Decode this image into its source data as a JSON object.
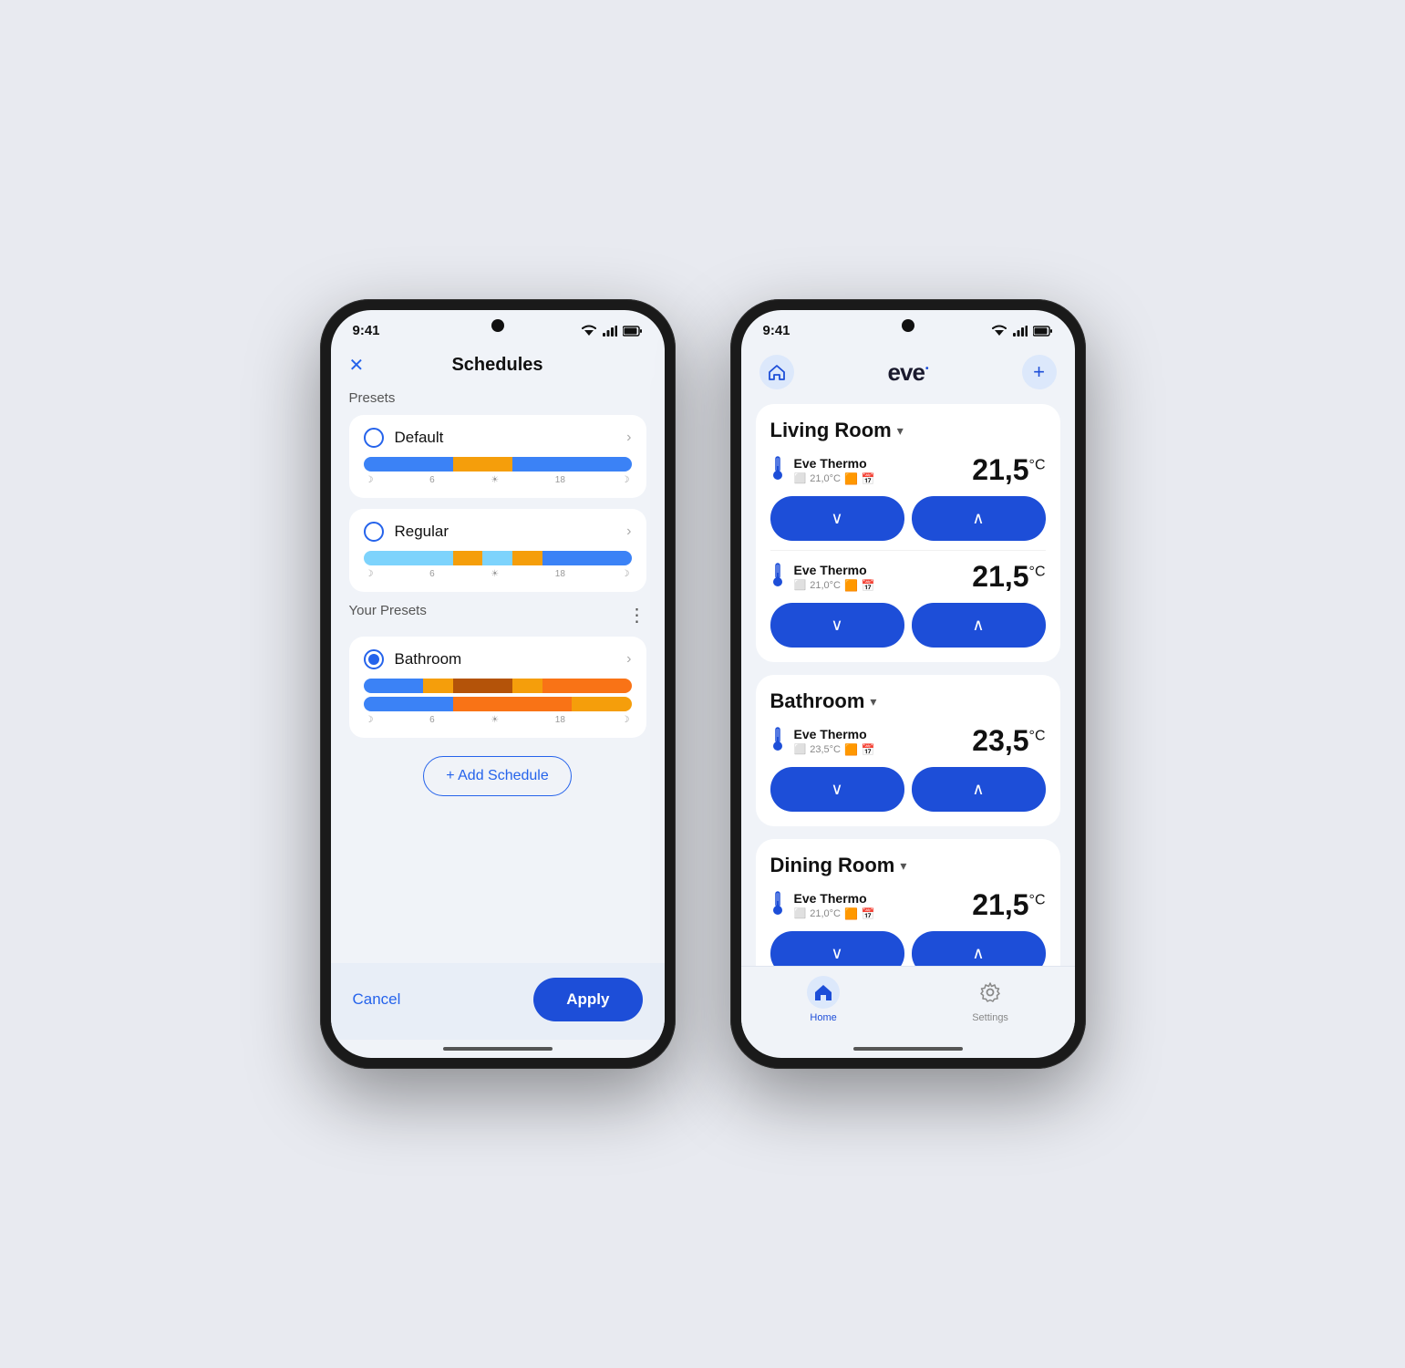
{
  "phone1": {
    "statusBar": {
      "time": "9:41"
    },
    "header": {
      "title": "Schedules",
      "closeLabel": "✕"
    },
    "sections": {
      "presets": "Presets",
      "yourPresets": "Your Presets"
    },
    "presets": [
      {
        "name": "Default",
        "selected": false,
        "segments": [
          {
            "color": "#3b82f6",
            "flex": 3
          },
          {
            "color": "#f59e0b",
            "flex": 2
          },
          {
            "color": "#3b82f6",
            "flex": 1
          },
          {
            "color": "#3b82f6",
            "flex": 3
          }
        ]
      },
      {
        "name": "Regular",
        "selected": false,
        "segments": [
          {
            "color": "#7dd3fc",
            "flex": 3
          },
          {
            "color": "#f59e0b",
            "flex": 1
          },
          {
            "color": "#7dd3fc",
            "flex": 1
          },
          {
            "color": "#f59e0b",
            "flex": 1
          },
          {
            "color": "#3b82f6",
            "flex": 3
          }
        ]
      }
    ],
    "yourPresets": [
      {
        "name": "Bathroom",
        "selected": true,
        "segments": [
          {
            "color": "#3b82f6",
            "flex": 2
          },
          {
            "color": "#f59e0b",
            "flex": 1
          },
          {
            "color": "#b45309",
            "flex": 2
          },
          {
            "color": "#f59e0b",
            "flex": 1
          },
          {
            "color": "#f97316",
            "flex": 3
          }
        ]
      }
    ],
    "barLabels": [
      "☽",
      "6",
      "☀",
      "18",
      "☽"
    ],
    "addSchedule": "+ Add Schedule",
    "bottomBar": {
      "cancel": "Cancel",
      "apply": "Apply"
    }
  },
  "phone2": {
    "statusBar": {
      "time": "9:41"
    },
    "logo": "eve.",
    "rooms": [
      {
        "name": "Living Room",
        "devices": [
          {
            "name": "Eve Thermo",
            "sub": "21,0°C",
            "temp": "21,5",
            "unit": "°C",
            "icons": [
              "🟧",
              "📅"
            ]
          },
          {
            "name": "Eve Thermo",
            "sub": "21,0°C",
            "temp": "21,5",
            "unit": "°C",
            "icons": [
              "🟧",
              "📅"
            ]
          }
        ]
      },
      {
        "name": "Bathroom",
        "devices": [
          {
            "name": "Eve Thermo",
            "sub": "23,5°C",
            "temp": "23,5",
            "unit": "°C",
            "icons": [
              "🟧",
              "📅"
            ]
          }
        ]
      },
      {
        "name": "Dining Room",
        "devices": [
          {
            "name": "Eve Thermo",
            "sub": "21,0°C",
            "temp": "21,5",
            "unit": "°C",
            "icons": [
              "🟧",
              "📅"
            ]
          }
        ]
      }
    ],
    "nav": {
      "home": "Home",
      "settings": "Settings"
    }
  }
}
